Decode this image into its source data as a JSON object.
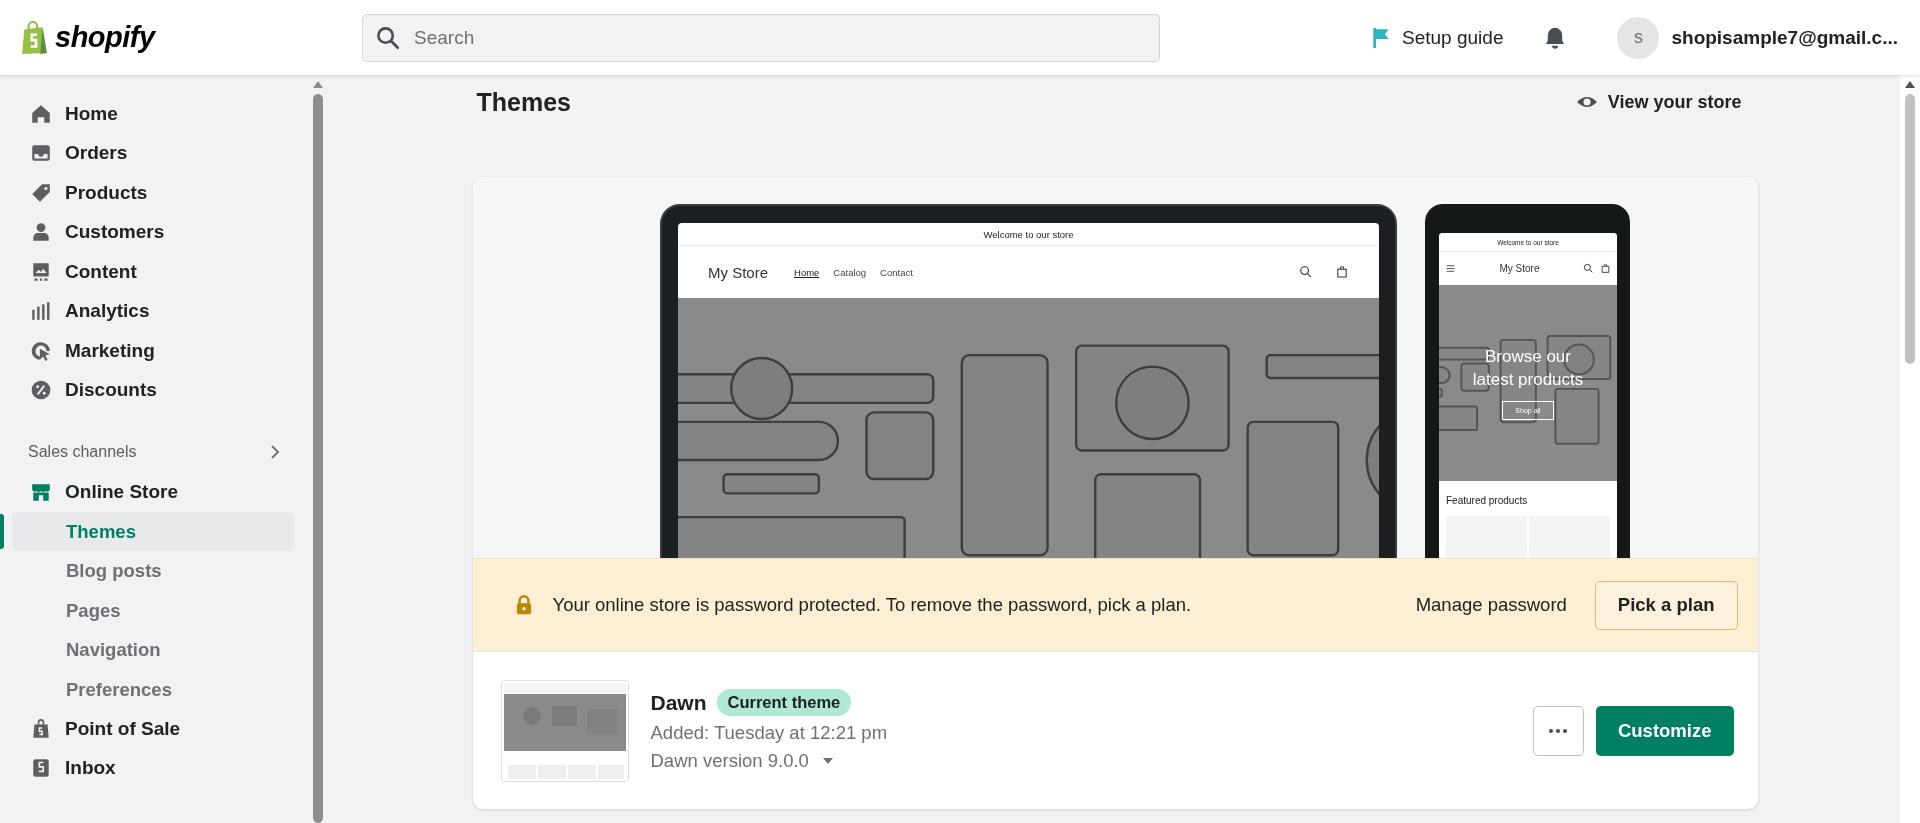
{
  "topbar": {
    "logo": "shopify",
    "search": {
      "placeholder": "Search"
    },
    "setup_guide": "Setup guide",
    "account": {
      "avatar_initial": "s",
      "email": "shopisample7@gmail.c..."
    }
  },
  "sidebar": {
    "main_items": [
      {
        "label": "Home",
        "selected": false
      },
      {
        "label": "Orders",
        "selected": false
      },
      {
        "label": "Products",
        "selected": false
      },
      {
        "label": "Customers",
        "selected": false
      },
      {
        "label": "Content",
        "selected": false
      },
      {
        "label": "Analytics",
        "selected": false
      },
      {
        "label": "Marketing",
        "selected": false
      },
      {
        "label": "Discounts",
        "selected": false
      }
    ],
    "sales_channels": {
      "title": "Sales channels",
      "items": [
        {
          "label": "Online Store",
          "selected": false,
          "expanded": true,
          "children": [
            {
              "label": "Themes",
              "selected": true
            },
            {
              "label": "Blog posts",
              "selected": false
            },
            {
              "label": "Pages",
              "selected": false
            },
            {
              "label": "Navigation",
              "selected": false
            },
            {
              "label": "Preferences",
              "selected": false
            }
          ]
        },
        {
          "label": "Point of Sale",
          "selected": false,
          "expanded": false
        },
        {
          "label": "Inbox",
          "selected": false,
          "expanded": false
        }
      ]
    }
  },
  "page": {
    "title": "Themes",
    "view_store": "View your store"
  },
  "preview": {
    "desktop": {
      "announcement": "Welcome to our store",
      "store_name": "My Store",
      "nav": [
        {
          "label": "Home",
          "selected": true
        },
        {
          "label": "Catalog",
          "selected": false
        },
        {
          "label": "Contact",
          "selected": false
        }
      ]
    },
    "mobile": {
      "announcement": "Welcome to our store",
      "store_name": "My Store",
      "hero_title": "Browse our latest products",
      "hero_button": "Shop all",
      "section_title": "Featured products"
    }
  },
  "banner": {
    "message": "Your online store is password protected. To remove the password, pick a plan.",
    "link": "Manage password",
    "button": "Pick a plan"
  },
  "theme": {
    "name": "Dawn",
    "badge": "Current theme",
    "added": "Added: Tuesday at 12:21 pm",
    "version": "Dawn version 9.0.0",
    "customize_button": "Customize"
  }
}
